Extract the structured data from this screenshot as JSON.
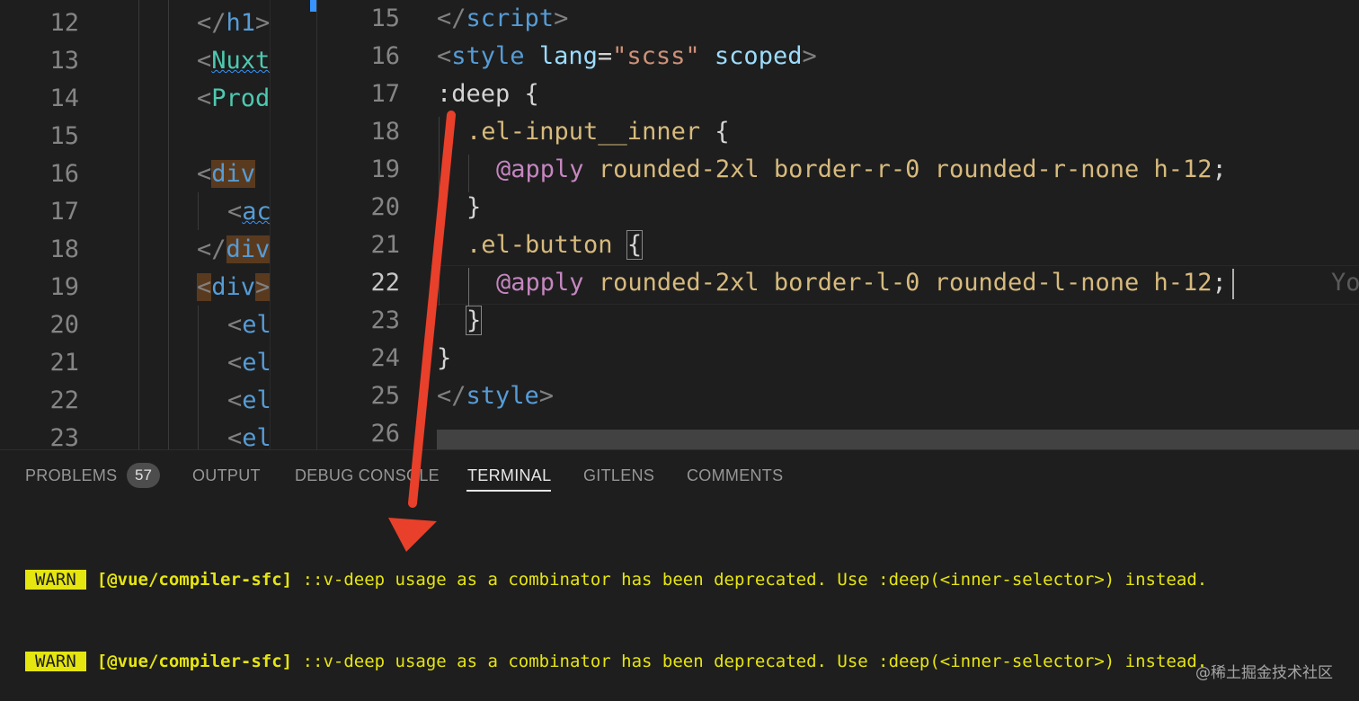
{
  "left_pane": {
    "line_numbers": [
      "12",
      "13",
      "14",
      "15",
      "16",
      "17",
      "18",
      "19",
      "20",
      "21",
      "22",
      "23"
    ],
    "code": [
      {
        "open": "</",
        "name": "h1",
        "close": ">"
      },
      {
        "open": "<",
        "name": "Nuxt",
        "close": ""
      },
      {
        "open": "<",
        "name": "Prod",
        "close": ""
      },
      {
        "open": "",
        "name": "",
        "close": ""
      },
      {
        "open": "<",
        "name": "div",
        "close": ""
      },
      {
        "open": "<",
        "name": "ac",
        "close": ""
      },
      {
        "open": "</",
        "name": "div",
        "close": ""
      },
      {
        "open": "<",
        "name": "div",
        "close": ">"
      },
      {
        "open": "<",
        "name": "el",
        "close": ""
      },
      {
        "open": "<",
        "name": "el",
        "close": ""
      },
      {
        "open": "<",
        "name": "el",
        "close": ""
      },
      {
        "open": "<",
        "name": "el",
        "close": ""
      }
    ]
  },
  "right_pane": {
    "line_numbers": [
      "15",
      "16",
      "17",
      "18",
      "19",
      "20",
      "21",
      "22",
      "23",
      "24",
      "25",
      "26"
    ],
    "active_line": "22",
    "lines": {
      "l15": {
        "open": "</",
        "tag": "script",
        "close": ">"
      },
      "l16": {
        "open": "<",
        "tag": "style",
        "attr1": "lang",
        "eq": "=",
        "str": "\"scss\"",
        "attr2": "scoped",
        "close": ">"
      },
      "l17": {
        "sel": ":deep",
        "brace": "{"
      },
      "l18": {
        "sel": ".el-input__inner",
        "brace": "{"
      },
      "l19": {
        "at": "@apply",
        "val": "rounded-2xl border-r-0 rounded-r-none h-12",
        "semi": ";"
      },
      "l20": {
        "brace": "}"
      },
      "l21": {
        "sel": ".el-button",
        "brace": "{"
      },
      "l22": {
        "at": "@apply",
        "val": "rounded-2xl border-l-0 rounded-l-none h-12",
        "semi": ";",
        "ghost": "Yo"
      },
      "l23": {
        "brace": "}"
      },
      "l24": {
        "brace": "}"
      },
      "l25": {
        "open": "</",
        "tag": "style",
        "close": ">"
      }
    }
  },
  "panel": {
    "tabs": [
      "PROBLEMS",
      "OUTPUT",
      "DEBUG CONSOLE",
      "TERMINAL",
      "GITLENS",
      "COMMENTS"
    ],
    "problems_count": "57",
    "active_tab": "TERMINAL"
  },
  "terminal": {
    "lines": [
      {
        "badge": "WARN",
        "source": "[@vue/compiler-sfc]",
        "message": "::v-deep usage as a combinator has been deprecated. Use :deep(<inner-selector>) instead."
      },
      {
        "badge": "WARN",
        "source": "[@vue/compiler-sfc]",
        "message": "::v-deep usage as a combinator has been deprecated. Use :deep(<inner-selector>) instead."
      }
    ]
  },
  "watermark": "@稀土掘金技术社区",
  "colors": {
    "arrow": "#e8402a",
    "warn": "#e5e510",
    "accent": "#3794ff"
  }
}
